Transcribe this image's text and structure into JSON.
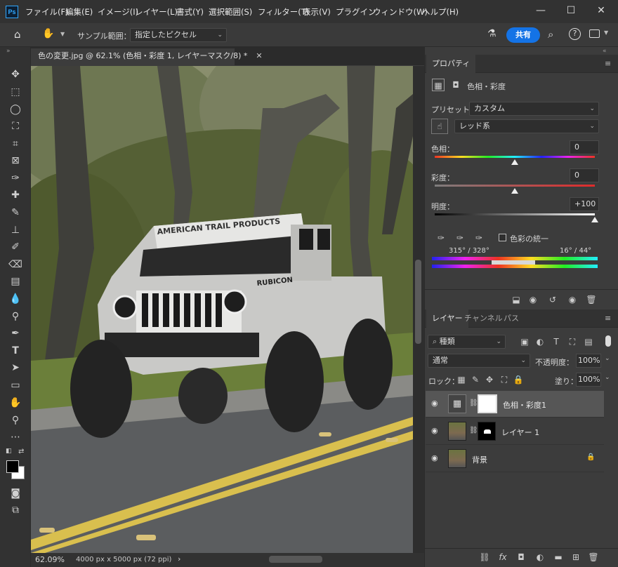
{
  "app": {
    "logo": "Ps"
  },
  "menu": [
    "ファイル(F)",
    "編集(E)",
    "イメージ(I)",
    "レイヤー(L)",
    "書式(Y)",
    "選択範囲(S)",
    "フィルター(T)",
    "表示(V)",
    "プラグイン",
    "ウィンドウ(W)",
    "ヘルプ(H)"
  ],
  "window_controls": {
    "minimize": "—",
    "maximize": "☐",
    "close": "✕"
  },
  "options_bar": {
    "sample_label": "サンプル範囲：",
    "sample_value": "指定したピクセル",
    "share_label": "共有"
  },
  "document": {
    "tab_title": "色の変更.jpg @ 62.1% (色相・彩度 1, レイヤーマスク/8) *",
    "canvas_text": "AMERICAN TRAIL PRODUCTS",
    "badge_text": "RUBICON"
  },
  "status": {
    "zoom": "62.09%",
    "info": "4000 px x 5000 px (72 ppi)",
    "arrow": "›"
  },
  "properties": {
    "tab_label": "プロパティ",
    "title": "色相・彩度",
    "preset_label": "プリセット：",
    "preset_value": "カスタム",
    "channel_value": "レッド系",
    "hue_label": "色相：",
    "hue_value": "0",
    "saturation_label": "彩度：",
    "saturation_value": "0",
    "lightness_label": "明度：",
    "lightness_value": "+100",
    "hue_position": 0.5,
    "saturation_position": 0.5,
    "lightness_position": 1.0,
    "colorize_label": "色彩の統一",
    "range_left": "315° / 328°",
    "range_right": "16° / 44°"
  },
  "layers": {
    "tabs": [
      "レイヤー",
      "チャンネル",
      "パス"
    ],
    "filter_value": "種類",
    "blend_mode": "通常",
    "opacity_label": "不透明度：",
    "opacity_value": "100%",
    "lock_label": "ロック：",
    "fill_label": "塗り：",
    "fill_value": "100%",
    "items": [
      {
        "name": "色相・彩度1",
        "selected": true
      },
      {
        "name": "レイヤー 1",
        "selected": false
      },
      {
        "name": "背景",
        "selected": false
      }
    ]
  },
  "colors": {
    "accent": "#1473e6",
    "panel": "#3c3c3c",
    "hue_track_mid": "#7b3b3b"
  }
}
